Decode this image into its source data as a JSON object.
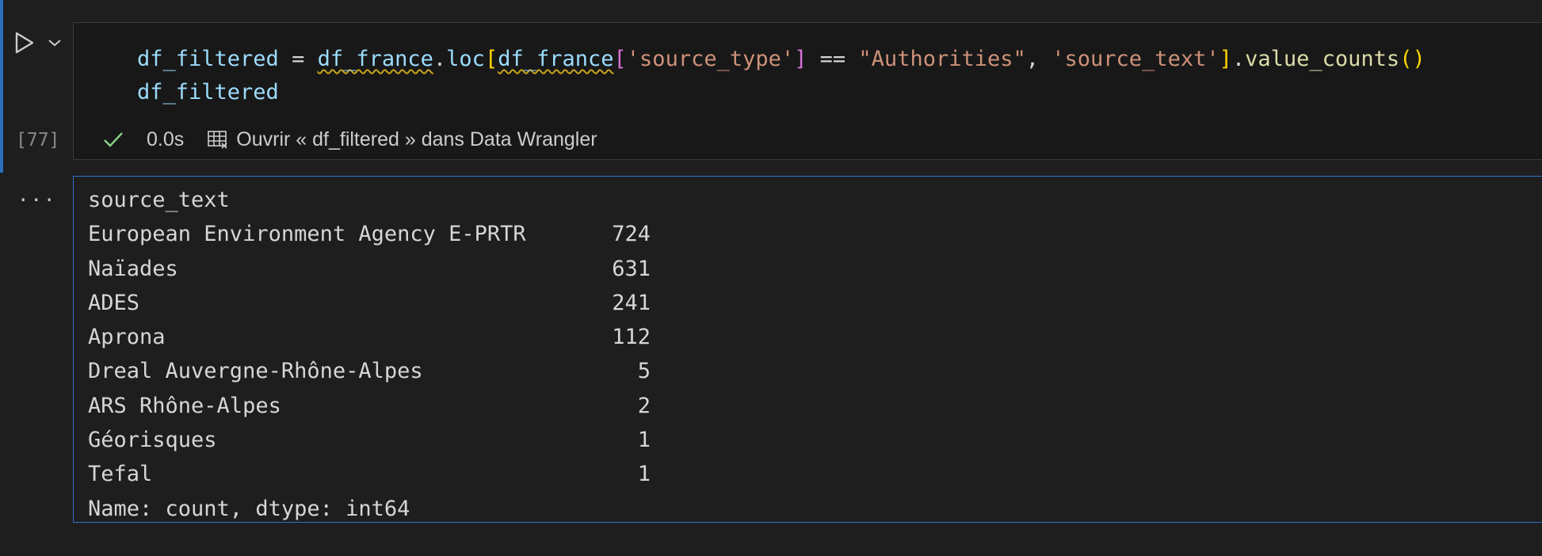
{
  "cell": {
    "execution_count": "[77]",
    "exec_time": "0.0s",
    "data_wrangler_link": "Ouvrir « df_filtered » dans Data Wrangler",
    "output_menu": "...",
    "code": {
      "line1": {
        "t1": "df_filtered",
        "t2": " = ",
        "t3": "df_france",
        "t4": ".",
        "t5": "loc",
        "t6": "[",
        "t7": "df_france",
        "t8": "[",
        "t9": "'source_type'",
        "t10": "]",
        "t11": " == ",
        "t12": "\"Authorities\"",
        "t13": ", ",
        "t14": "'source_text'",
        "t15": "]",
        "t16": ".",
        "t17": "value_counts",
        "t18": "()"
      },
      "line2": "df_filtered"
    }
  },
  "output": {
    "header": "source_text",
    "rows": [
      {
        "label": "European Environment Agency E-PRTR",
        "count": "724"
      },
      {
        "label": "Naïades",
        "count": "631"
      },
      {
        "label": "ADES",
        "count": "241"
      },
      {
        "label": "Aprona",
        "count": "112"
      },
      {
        "label": "Dreal Auvergne-Rhône-Alpes",
        "count": "5"
      },
      {
        "label": "ARS Rhône-Alpes",
        "count": "2"
      },
      {
        "label": "Géorisques",
        "count": "1"
      },
      {
        "label": "Tefal",
        "count": "1"
      }
    ],
    "footer": "Name: count, dtype: int64"
  },
  "colors": {
    "background": "#1e1e1e",
    "focus_accent": "#2b6fb8",
    "success": "#89d185"
  },
  "icons": {
    "run": "play-icon",
    "run_options": "chevron-down-icon",
    "status": "check-icon",
    "wrangler": "grid-icon"
  }
}
